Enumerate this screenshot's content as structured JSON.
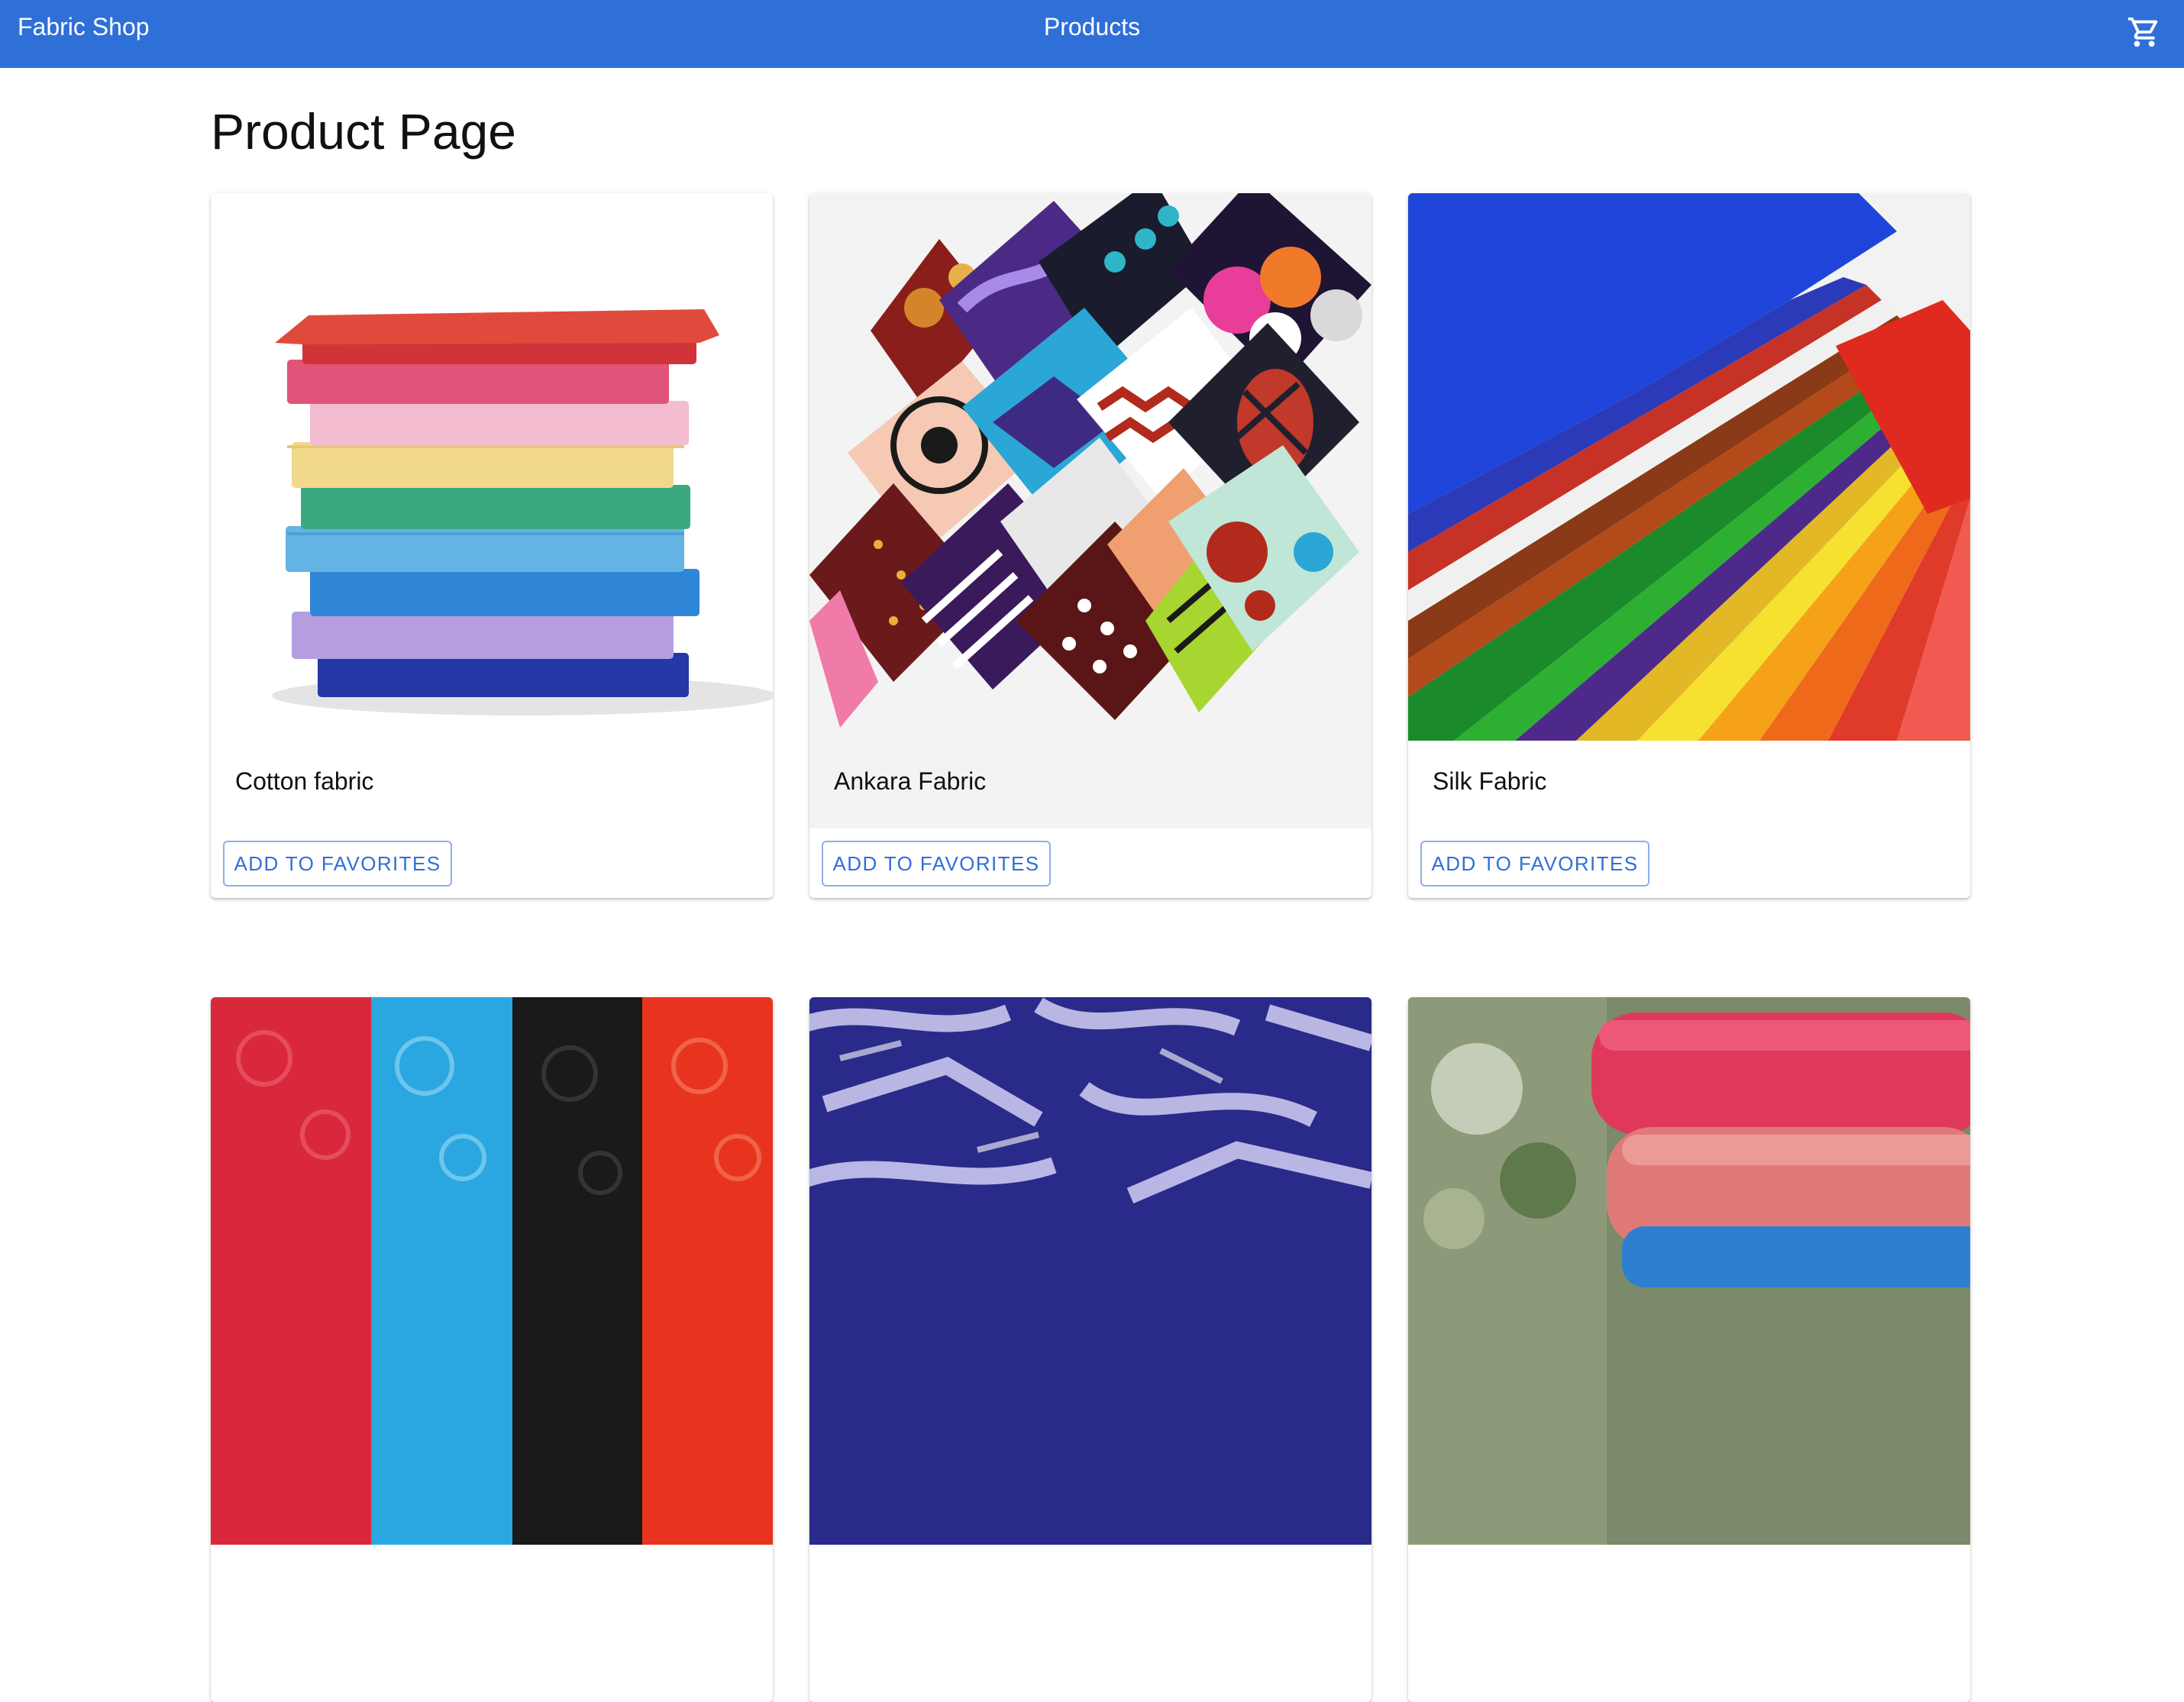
{
  "appbar": {
    "brand": "Fabric Shop",
    "title": "Products",
    "cart_icon": "shopping-cart-icon",
    "color": "#2f6fd8"
  },
  "page": {
    "heading": "Product Page"
  },
  "products": [
    {
      "name": "Cotton fabric",
      "action_label": "ADD TO FAVORITES",
      "image": "stacked-cotton-fabric"
    },
    {
      "name": "Ankara Fabric",
      "action_label": "ADD TO FAVORITES",
      "image": "ankara-print-fabric"
    },
    {
      "name": "Silk Fabric",
      "action_label": "ADD TO FAVORITES",
      "image": "silk-fabric-fan"
    },
    {
      "image": "lace-fabric"
    },
    {
      "image": "batik-fabric"
    },
    {
      "image": "wool-fabric"
    }
  ],
  "colors": {
    "accent": "#2f6fd8",
    "button_border": "#8eb0e8"
  }
}
